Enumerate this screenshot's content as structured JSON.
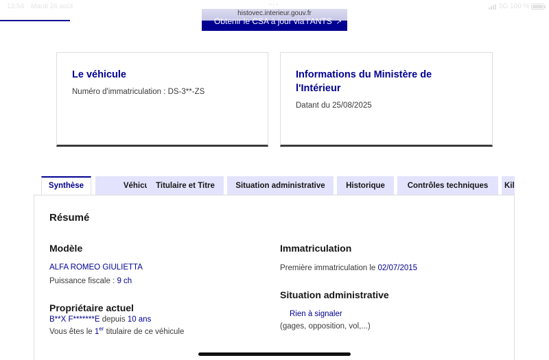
{
  "status_bar": {
    "time": "13:54",
    "date": "Mardi 26 août",
    "url": "histovec.interieur.gouv.fr",
    "network": "5G",
    "battery": "100 %",
    "battery_level": 1.0,
    "more_icon": "ellipsis-icon"
  },
  "header": {
    "ants_button_label": "Obtenir le CSA à jour via l'ANTS",
    "ants_button_icon": "external-link-icon"
  },
  "card_vehicule": {
    "title": "Le véhicule",
    "text": "Numéro d'immatriculation : DS-3**-ZS"
  },
  "card_ministere": {
    "title": "Informations du Ministère de l'Intérieur",
    "text": "Datant du 25/08/2025"
  },
  "tabs": [
    "Synthèse",
    "Véhicule",
    "Titulaire et Titre",
    "Situation administrative",
    "Historique",
    "Contrôles techniques",
    "Kilométrage"
  ],
  "resume": {
    "title": "Résumé",
    "modele": {
      "heading": "Modèle",
      "name": "ALFA ROMEO GIULIETTA",
      "puissance_label": "Puissance fiscale : ",
      "puissance_value": "9 ch"
    },
    "proprietaire": {
      "heading": "Propriétaire actuel",
      "name": "B**X F*******E",
      "depuis_label": " depuis ",
      "depuis_value": "10 ans",
      "titulaire_prefix": "Vous êtes le ",
      "titulaire_rank": "1",
      "titulaire_rank_sup": "er",
      "titulaire_suffix": " titulaire de ce véhicule"
    },
    "immatriculation": {
      "heading": "Immatriculation",
      "label": "Première immatriculation le ",
      "date": "02/07/2015"
    },
    "situation": {
      "heading": "Situation administrative",
      "status": "Rien à signaler",
      "detail": "(gages, opposition, vol,...)"
    }
  },
  "colors": {
    "primary": "#000091",
    "tab_inactive": "#e3e3fd",
    "text": "#161616"
  }
}
